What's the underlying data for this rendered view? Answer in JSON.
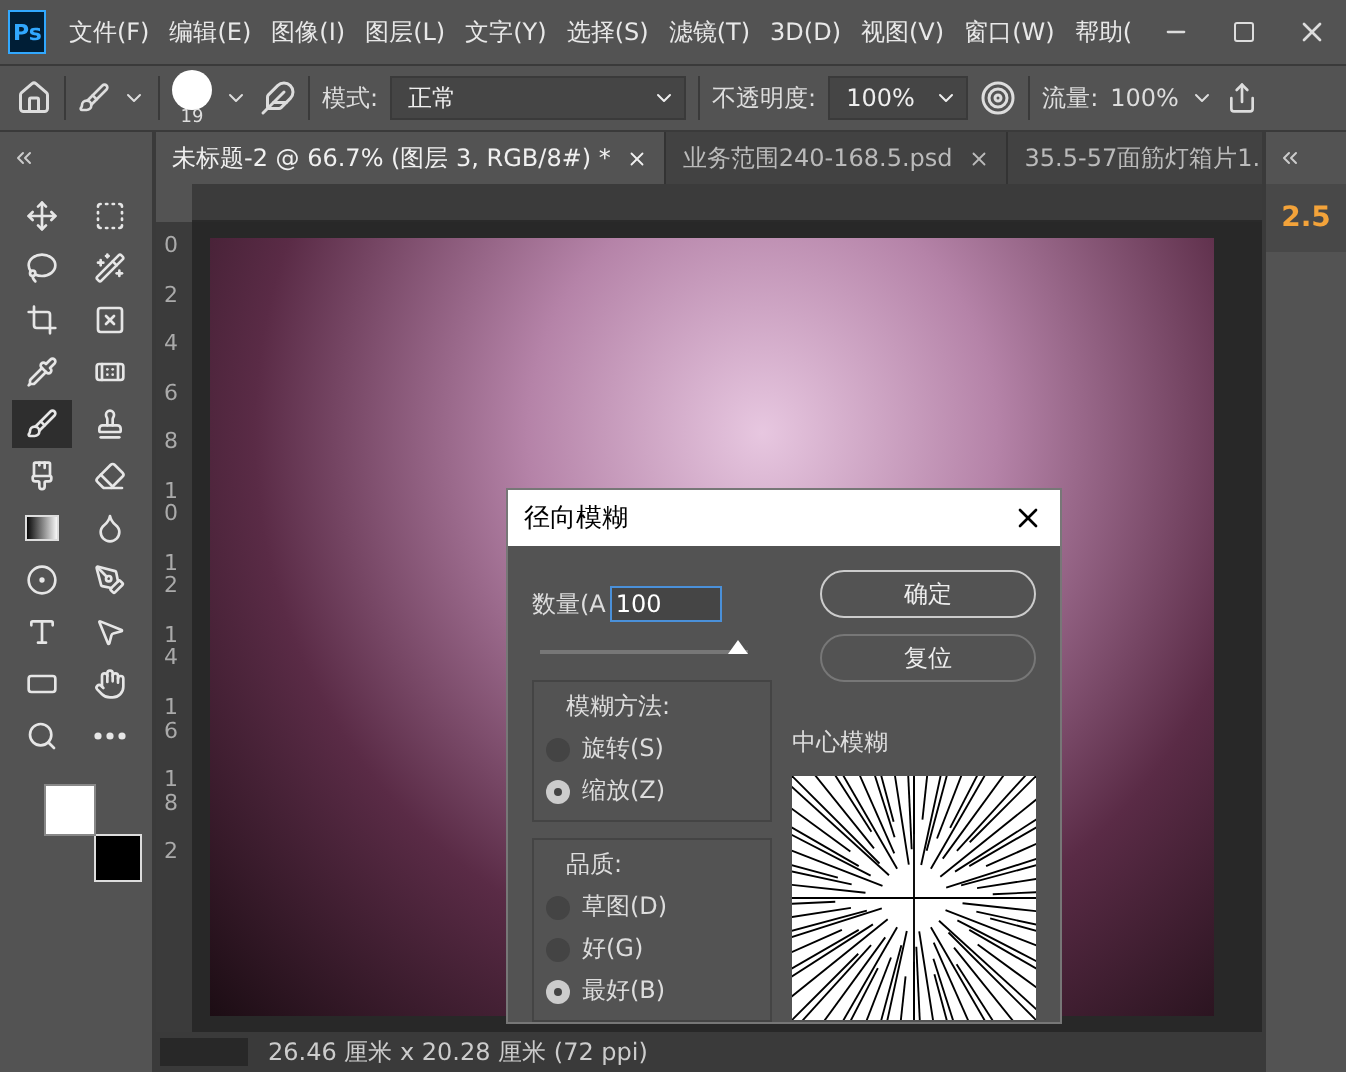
{
  "app": {
    "logo": "Ps"
  },
  "menu": [
    "文件(F)",
    "编辑(E)",
    "图像(I)",
    "图层(L)",
    "文字(Y)",
    "选择(S)",
    "滤镜(T)",
    "3D(D)",
    "视图(V)",
    "窗口(W)",
    "帮助("
  ],
  "options": {
    "brush_size": "19",
    "mode_label": "模式:",
    "mode": "正常",
    "opacity_label": "不透明度:",
    "opacity": "100%",
    "flow_label": "流量:",
    "flow": "100%"
  },
  "tabs": [
    {
      "label": "未标题-2 @ 66.7% (图层 3, RGB/8#) *",
      "selected": true
    },
    {
      "label": "业务范围240-168.5.psd",
      "selected": false
    },
    {
      "label": "35.5-57面筋灯箱片1.",
      "selected": false
    }
  ],
  "tools": [
    {
      "kind": "move",
      "selected": false
    },
    {
      "kind": "marquee",
      "selected": false
    },
    {
      "kind": "lasso",
      "selected": false
    },
    {
      "kind": "wand",
      "selected": false
    },
    {
      "kind": "crop",
      "selected": false
    },
    {
      "kind": "frame",
      "selected": false
    },
    {
      "kind": "eyedropper",
      "selected": false
    },
    {
      "kind": "bandage",
      "selected": false
    },
    {
      "kind": "brush",
      "selected": true
    },
    {
      "kind": "stamp",
      "selected": false
    },
    {
      "kind": "history",
      "selected": false
    },
    {
      "kind": "eraser",
      "selected": false
    },
    {
      "kind": "gradient",
      "selected": false
    },
    {
      "kind": "drop",
      "selected": false
    },
    {
      "kind": "dodge",
      "selected": false
    },
    {
      "kind": "pen",
      "selected": false
    },
    {
      "kind": "type",
      "selected": false
    },
    {
      "kind": "pointer",
      "selected": false
    },
    {
      "kind": "rect",
      "selected": false
    },
    {
      "kind": "hand",
      "selected": false
    },
    {
      "kind": "zoom",
      "selected": false
    },
    {
      "kind": "more",
      "selected": false
    }
  ],
  "ruler": [
    "0",
    "2",
    "4",
    "6",
    "8",
    "10",
    "12",
    "14",
    "16",
    "18",
    "2"
  ],
  "panel": {
    "value": "2.5"
  },
  "status": "26.46 厘米 x 20.28 厘米 (72 ppi)",
  "dialog": {
    "title": "径向模糊",
    "amount_label": "数量(A",
    "amount": "100",
    "level": 1.0,
    "ok": "确定",
    "reset": "复位",
    "method": {
      "legend": "模糊方法:",
      "options": [
        {
          "label": "旋转(S)",
          "selected": false
        },
        {
          "label": "缩放(Z)",
          "selected": true
        }
      ]
    },
    "quality": {
      "legend": "品质:",
      "options": [
        {
          "label": "草图(D)",
          "selected": false
        },
        {
          "label": "好(G)",
          "selected": false
        },
        {
          "label": "最好(B)",
          "selected": true
        }
      ]
    },
    "preview_label": "中心模糊"
  }
}
